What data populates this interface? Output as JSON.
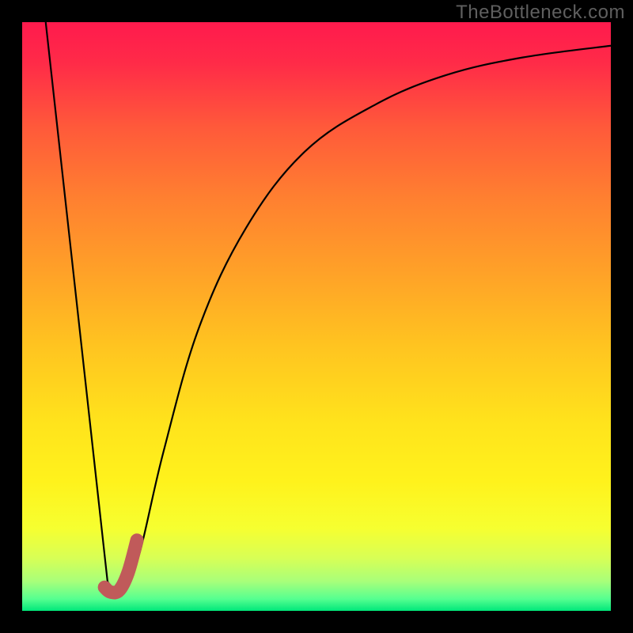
{
  "watermark": "TheBottleneck.com",
  "chart_data": {
    "type": "line",
    "title": "",
    "xlabel": "",
    "ylabel": "",
    "xlim": [
      0,
      100
    ],
    "ylim": [
      0,
      100
    ],
    "background": {
      "gradient_type": "vertical",
      "stops": [
        {
          "pos": 0.0,
          "color": "#ff1a4d"
        },
        {
          "pos": 0.07,
          "color": "#ff2b48"
        },
        {
          "pos": 0.18,
          "color": "#ff5a3a"
        },
        {
          "pos": 0.3,
          "color": "#ff8030"
        },
        {
          "pos": 0.42,
          "color": "#ffa028"
        },
        {
          "pos": 0.55,
          "color": "#ffc420"
        },
        {
          "pos": 0.68,
          "color": "#ffe31c"
        },
        {
          "pos": 0.78,
          "color": "#fff21c"
        },
        {
          "pos": 0.86,
          "color": "#f6ff30"
        },
        {
          "pos": 0.91,
          "color": "#d8ff55"
        },
        {
          "pos": 0.95,
          "color": "#a8ff7a"
        },
        {
          "pos": 0.98,
          "color": "#55ff90"
        },
        {
          "pos": 1.0,
          "color": "#00e77a"
        }
      ]
    },
    "series": [
      {
        "name": "bottleneck-curve",
        "stroke": "#010101",
        "points": [
          {
            "x": 4.0,
            "y": 100.0
          },
          {
            "x": 14.5,
            "y": 5.0
          },
          {
            "x": 15.8,
            "y": 3.0
          },
          {
            "x": 17.5,
            "y": 4.0
          },
          {
            "x": 20.0,
            "y": 10.0
          },
          {
            "x": 24.0,
            "y": 27.0
          },
          {
            "x": 30.0,
            "y": 48.0
          },
          {
            "x": 38.0,
            "y": 65.0
          },
          {
            "x": 48.0,
            "y": 78.0
          },
          {
            "x": 60.0,
            "y": 86.0
          },
          {
            "x": 72.0,
            "y": 91.0
          },
          {
            "x": 85.0,
            "y": 94.0
          },
          {
            "x": 100.0,
            "y": 96.0
          }
        ]
      }
    ],
    "marker": {
      "name": "selected-point-J",
      "stroke": "#c05a5a",
      "points": [
        {
          "x": 14.0,
          "y": 4.0
        },
        {
          "x": 15.0,
          "y": 3.2
        },
        {
          "x": 16.5,
          "y": 3.5
        },
        {
          "x": 18.0,
          "y": 6.5
        },
        {
          "x": 19.5,
          "y": 12.0
        }
      ]
    }
  }
}
